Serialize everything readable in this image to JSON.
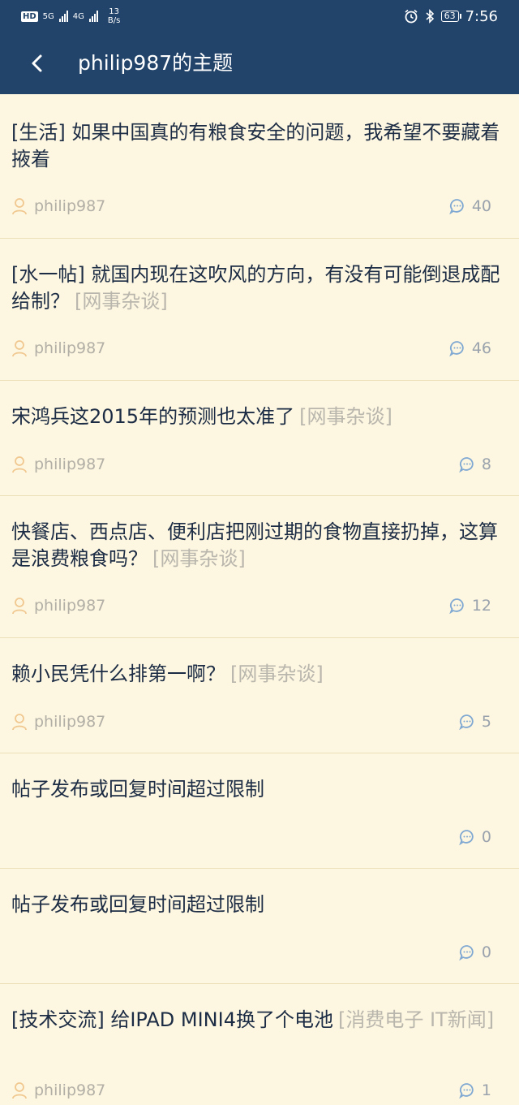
{
  "status_bar": {
    "hd": "HD",
    "net1": "5G",
    "net2": "4G",
    "speed_value": "13",
    "speed_unit": "B/s",
    "battery": "63",
    "time": "7:56"
  },
  "header": {
    "back_icon": "back-arrow-icon",
    "title": "philip987的主题"
  },
  "colors": {
    "header_bg": "#22446a",
    "page_bg": "#fdf6e0",
    "category": "#b9b6ad",
    "author_icon": "#f0c890",
    "reply_icon": "#7fa8d2"
  },
  "posts": [
    {
      "title": "[生活] 如果中国真的有粮食安全的问题，我希望不要藏着掖着",
      "category": "",
      "author": "philip987",
      "replies": "40"
    },
    {
      "title": "[水一帖] 就国内现在这吹风的方向，有没有可能倒退成配给制？",
      "category": "[网事杂谈]",
      "author": "philip987",
      "replies": "46"
    },
    {
      "title": "宋鸿兵这2015年的预测也太准了",
      "category": "[网事杂谈]",
      "author": "philip987",
      "replies": "8"
    },
    {
      "title": "快餐店、西点店、便利店把刚过期的食物直接扔掉，这算是浪费粮食吗？",
      "category": "[网事杂谈]",
      "author": "philip987",
      "replies": "12"
    },
    {
      "title": "赖小民凭什么排第一啊？",
      "category": "[网事杂谈]",
      "author": "philip987",
      "replies": "5"
    },
    {
      "title": "帖子发布或回复时间超过限制",
      "category": "",
      "author": "",
      "replies": "0"
    },
    {
      "title": "帖子发布或回复时间超过限制",
      "category": "",
      "author": "",
      "replies": "0"
    },
    {
      "title": "[技术交流] 给IPAD MINI4换了个电池",
      "category": "[消费电子 IT新闻]",
      "author": "philip987",
      "replies": "1"
    }
  ]
}
